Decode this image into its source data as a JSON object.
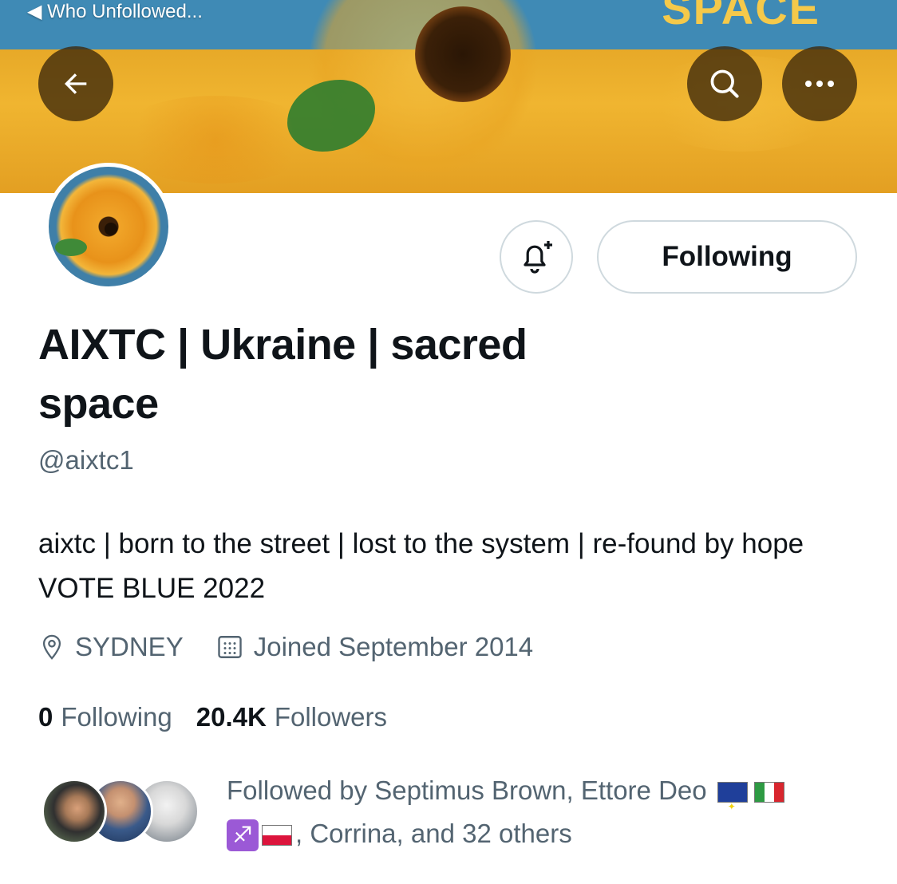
{
  "status_bar": {
    "back_app_label": "◀ Who Unfollowed..."
  },
  "banner": {
    "visible_text": "SPACE"
  },
  "profile": {
    "display_name": "AIXTC | Ukraine | sacred space",
    "handle": "@aixtc1",
    "bio": "aixtc | born to the street | lost to the system | re-found by hope VOTE BLUE 2022",
    "location": "SYDNEY",
    "joined": "Joined September 2014",
    "following_count": "0",
    "following_label": "Following",
    "followers_count": "20.4K",
    "followers_label": "Followers"
  },
  "actions": {
    "follow_state_label": "Following"
  },
  "followed_by": {
    "prefix": "Followed by Septimus Brown, Ettore Deo",
    "suffix": ", Corrina, and 32 others"
  },
  "icons": [
    "back-arrow-icon",
    "search-icon",
    "more-icon",
    "bell-plus-icon",
    "location-icon",
    "calendar-icon"
  ],
  "colors": {
    "text": "#0f1419",
    "secondary": "#536471",
    "border": "#cfd9de"
  }
}
